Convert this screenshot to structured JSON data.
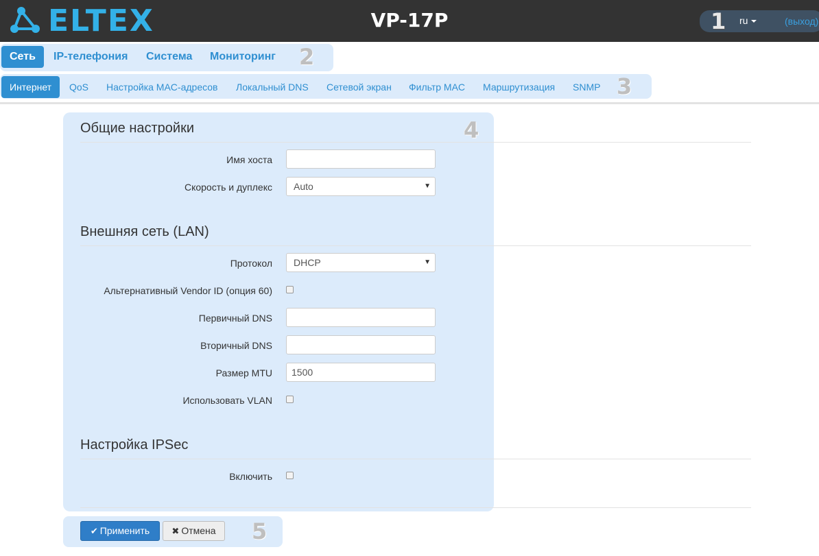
{
  "header": {
    "logo_text": "ELTEX",
    "device_title": "VP-17P",
    "language": "ru",
    "logout": "(выход)"
  },
  "annotations": [
    "1",
    "2",
    "3",
    "4",
    "5"
  ],
  "nav": {
    "items": [
      {
        "label": "Сеть",
        "active": true
      },
      {
        "label": "IP-телефония",
        "active": false
      },
      {
        "label": "Система",
        "active": false
      },
      {
        "label": "Мониторинг",
        "active": false
      }
    ]
  },
  "subnav": {
    "items": [
      {
        "label": "Интернет",
        "active": true
      },
      {
        "label": "QoS",
        "active": false
      },
      {
        "label": "Настройка MAC-адресов",
        "active": false
      },
      {
        "label": "Локальный DNS",
        "active": false
      },
      {
        "label": "Сетевой экран",
        "active": false
      },
      {
        "label": "Фильтр MAC",
        "active": false
      },
      {
        "label": "Маршрутизация",
        "active": false
      },
      {
        "label": "SNMP",
        "active": false
      }
    ]
  },
  "general": {
    "title": "Общие настройки",
    "hostname_label": "Имя хоста",
    "hostname_value": "",
    "speed_label": "Скорость и дуплекс",
    "speed_value": "Auto"
  },
  "lan": {
    "title": "Внешняя сеть (LAN)",
    "protocol_label": "Протокол",
    "protocol_value": "DHCP",
    "vendor_label": "Альтернативный Vendor ID (опция 60)",
    "vendor_checked": false,
    "dns1_label": "Первичный DNS",
    "dns1_value": "",
    "dns2_label": "Вторичный DNS",
    "dns2_value": "",
    "mtu_label": "Размер MTU",
    "mtu_value": "1500",
    "vlan_label": "Использовать VLAN",
    "vlan_checked": false
  },
  "ipsec": {
    "title": "Настройка IPSec",
    "enable_label": "Включить",
    "enable_checked": false
  },
  "buttons": {
    "apply": "Применить",
    "cancel": "Отмена"
  },
  "colors": {
    "header_bg": "#333333",
    "accent": "#2f8fd1",
    "logo": "#33b1e8",
    "highlight": "#dcebfb"
  }
}
